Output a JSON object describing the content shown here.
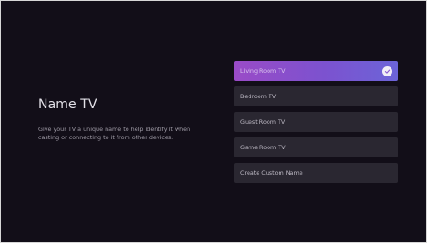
{
  "page": {
    "title": "Name TV",
    "description": "Give your TV a unique name to help identify it when casting or connecting to it from other devices."
  },
  "options": [
    {
      "label": "Living Room TV",
      "selected": true
    },
    {
      "label": "Bedroom TV",
      "selected": false
    },
    {
      "label": "Guest Room TV",
      "selected": false
    },
    {
      "label": "Game Room TV",
      "selected": false
    },
    {
      "label": "Create Custom Name",
      "selected": false
    }
  ],
  "colors": {
    "background": "#120e18",
    "selected_gradient_start": "#9a4bc7",
    "selected_gradient_end": "#6c64d8",
    "option_background": "#2a2731"
  },
  "icons": {
    "selected_indicator": "checkmark-circle-icon"
  }
}
